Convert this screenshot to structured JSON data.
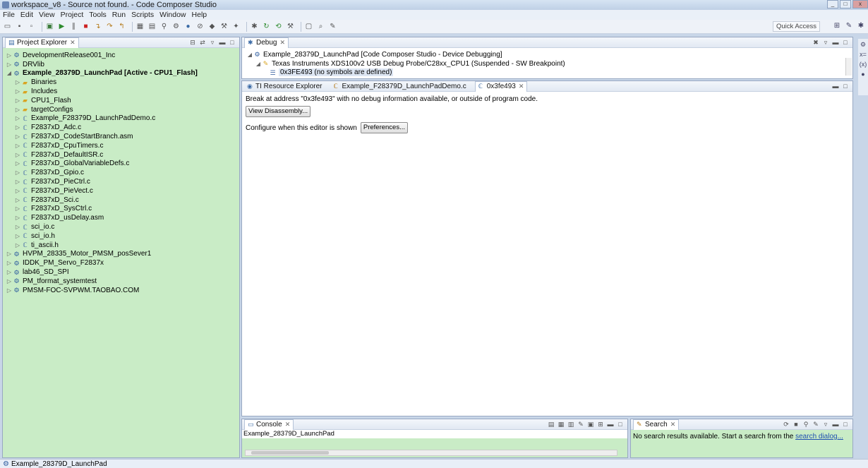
{
  "window": {
    "title": "workspace_v8 - Source not found. - Code Composer Studio",
    "controls": [
      "_",
      "□",
      "x"
    ]
  },
  "menu": [
    "File",
    "Edit",
    "View",
    "Project",
    "Tools",
    "Run",
    "Scripts",
    "Window",
    "Help"
  ],
  "toolbar": {
    "quick_access": "Quick Access"
  },
  "project_explorer": {
    "tab_label": "Project Explorer",
    "items": [
      {
        "label": "DevelopmentRelease001_Inc",
        "level": 0,
        "type": "project",
        "bold": false
      },
      {
        "label": "DRVlib",
        "level": 0,
        "type": "project",
        "bold": false
      },
      {
        "label": "Example_28379D_LaunchPad  [Active - CPU1_Flash]",
        "level": 0,
        "type": "project",
        "bold": true,
        "expanded": true
      },
      {
        "label": "Binaries",
        "level": 1,
        "type": "folder",
        "bold": false
      },
      {
        "label": "Includes",
        "level": 1,
        "type": "folder",
        "bold": false
      },
      {
        "label": "CPU1_Flash",
        "level": 1,
        "type": "folder",
        "bold": false
      },
      {
        "label": "targetConfigs",
        "level": 1,
        "type": "folder",
        "bold": false
      },
      {
        "label": "Example_F28379D_LaunchPadDemo.c",
        "level": 1,
        "type": "file",
        "bold": false
      },
      {
        "label": "F2837xD_Adc.c",
        "level": 1,
        "type": "file",
        "bold": false
      },
      {
        "label": "F2837xD_CodeStartBranch.asm",
        "level": 1,
        "type": "file",
        "bold": false
      },
      {
        "label": "F2837xD_CpuTimers.c",
        "level": 1,
        "type": "file",
        "bold": false
      },
      {
        "label": "F2837xD_DefaultISR.c",
        "level": 1,
        "type": "file",
        "bold": false
      },
      {
        "label": "F2837xD_GlobalVariableDefs.c",
        "level": 1,
        "type": "file",
        "bold": false
      },
      {
        "label": "F2837xD_Gpio.c",
        "level": 1,
        "type": "file",
        "bold": false
      },
      {
        "label": "F2837xD_PieCtrl.c",
        "level": 1,
        "type": "file",
        "bold": false
      },
      {
        "label": "F2837xD_PieVect.c",
        "level": 1,
        "type": "file",
        "bold": false
      },
      {
        "label": "F2837xD_Sci.c",
        "level": 1,
        "type": "file",
        "bold": false
      },
      {
        "label": "F2837xD_SysCtrl.c",
        "level": 1,
        "type": "file",
        "bold": false
      },
      {
        "label": "F2837xD_usDelay.asm",
        "level": 1,
        "type": "file",
        "bold": false
      },
      {
        "label": "sci_io.c",
        "level": 1,
        "type": "file",
        "bold": false
      },
      {
        "label": "sci_io.h",
        "level": 1,
        "type": "file",
        "bold": false
      },
      {
        "label": "ti_ascii.h",
        "level": 1,
        "type": "file",
        "bold": false
      },
      {
        "label": "HVPM_28335_Motor_PMSM_posSever1",
        "level": 0,
        "type": "project",
        "bold": false
      },
      {
        "label": "IDDK_PM_Servo_F2837x",
        "level": 0,
        "type": "project",
        "bold": false
      },
      {
        "label": "lab46_SD_SPI",
        "level": 0,
        "type": "project",
        "bold": false
      },
      {
        "label": "PM_tformat_systemtest",
        "level": 0,
        "type": "project",
        "bold": false
      },
      {
        "label": "PMSM-FOC-SVPWM.TAOBAO.COM",
        "level": 0,
        "type": "project",
        "bold": false
      }
    ]
  },
  "debug": {
    "tab_label": "Debug",
    "rows": [
      {
        "label": "Example_28379D_LaunchPad [Code Composer Studio - Device Debugging]",
        "level": 0
      },
      {
        "label": "Texas Instruments XDS100v2 USB Debug Probe/C28xx_CPU1 (Suspended - SW Breakpoint)",
        "level": 1
      },
      {
        "label": "0x3FE493  (no symbols are defined)",
        "level": 2
      }
    ]
  },
  "editor": {
    "tabs": [
      "TI Resource Explorer",
      "Example_F28379D_LaunchPadDemo.c",
      "0x3fe493"
    ],
    "message": "Break at address \"0x3fe493\" with no debug information available, or outside of program code.",
    "view_disassembly_label": "View Disassembly...",
    "configure_text": "Configure when this editor is shown",
    "preferences_label": "Preferences..."
  },
  "console": {
    "tab_label": "Console",
    "name": "Example_28379D_LaunchPad"
  },
  "search": {
    "tab_label": "Search",
    "message": "No search results available. Start a search from the",
    "link": "search dialog..."
  },
  "status": {
    "text": "Example_28379D_LaunchPad"
  },
  "colors": {
    "panel_green": "#c9ecc6",
    "link_blue": "#1f4fb0"
  }
}
